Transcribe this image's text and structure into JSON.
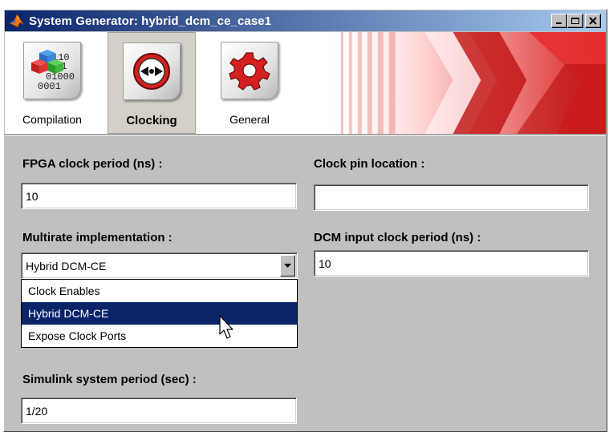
{
  "window": {
    "title": "System Generator: hybrid_dcm_ce_case1"
  },
  "toolbar": {
    "items": [
      {
        "label": "Compilation",
        "icon": "compilation-icon"
      },
      {
        "label": "Clocking",
        "icon": "clocking-icon"
      },
      {
        "label": "General",
        "icon": "general-icon"
      }
    ],
    "selected": "Clocking"
  },
  "form": {
    "fpga_clock_period": {
      "label": "FPGA clock period (ns) :",
      "value": "10"
    },
    "clock_pin_location": {
      "label": "Clock pin location :",
      "value": ""
    },
    "multirate_implementation": {
      "label": "Multirate implementation :",
      "value": "Hybrid DCM-CE",
      "options": [
        "Clock Enables",
        "Hybrid DCM-CE",
        "Expose Clock Ports"
      ],
      "highlighted": "Hybrid DCM-CE"
    },
    "dcm_input_clock_period": {
      "label": "DCM input clock period (ns) :",
      "value": "10"
    },
    "simulink_system_period": {
      "label": "Simulink system period (sec) :",
      "value": "1/20"
    }
  },
  "colors": {
    "title_bar_start": "#0a246a",
    "title_bar_end": "#a6caf0",
    "highlight": "#0a246a",
    "banner_red": "#d81e1e",
    "dialog_bg": "#c0c0c0"
  }
}
